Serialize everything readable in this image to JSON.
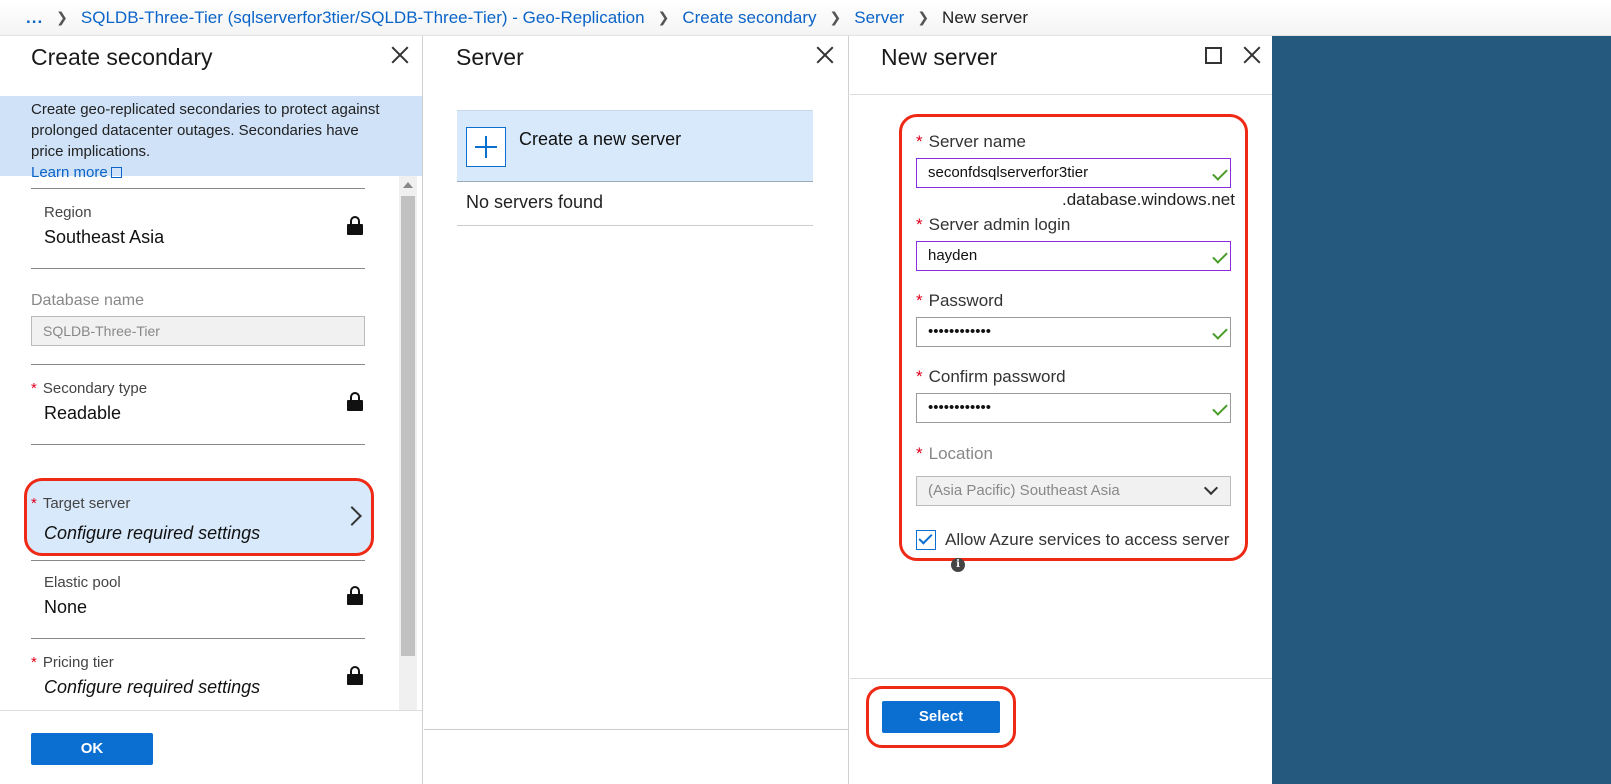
{
  "breadcrumb": {
    "ellipsis": "...",
    "items": [
      "SQLDB-Three-Tier (sqlserverfor3tier/SQLDB-Three-Tier) - Geo-Replication",
      "Create secondary",
      "Server"
    ],
    "current": "New server"
  },
  "blade1": {
    "title": "Create secondary",
    "info": "Create geo-replicated secondaries to protect against prolonged datacenter outages. Secondaries have price implications.",
    "learn_more": "Learn more",
    "region": {
      "label": "Region",
      "value": "Southeast Asia"
    },
    "database_name": {
      "label": "Database name",
      "placeholder": "SQLDB-Three-Tier"
    },
    "secondary_type": {
      "label": "Secondary type",
      "value": "Readable"
    },
    "target_server": {
      "label": "Target server",
      "value": "Configure required settings"
    },
    "elastic_pool": {
      "label": "Elastic pool",
      "value": "None"
    },
    "pricing_tier": {
      "label": "Pricing tier",
      "value": "Configure required settings"
    },
    "ok_label": "OK",
    "required_marker": "*"
  },
  "blade2": {
    "title": "Server",
    "create_new": "Create a new server",
    "no_servers": "No servers found"
  },
  "blade3": {
    "title": "New server",
    "server_name": {
      "label": "Server name",
      "value": "seconfdsqlserverfor3tier",
      "suffix": ".database.windows.net"
    },
    "admin_login": {
      "label": "Server admin login",
      "value": "hayden"
    },
    "password": {
      "label": "Password",
      "value": "••••••••••••"
    },
    "confirm_password": {
      "label": "Confirm password",
      "value": "••••••••••••"
    },
    "location": {
      "label": "Location",
      "value": "(Asia Pacific) Southeast Asia"
    },
    "allow_azure": {
      "label": "Allow Azure services to access server",
      "checked": true
    },
    "select_label": "Select"
  },
  "colors": {
    "accent": "#0b6fd1",
    "highlight": "#ee2a16",
    "background_right": "#255a7e",
    "valid": "#4a9d2a"
  }
}
